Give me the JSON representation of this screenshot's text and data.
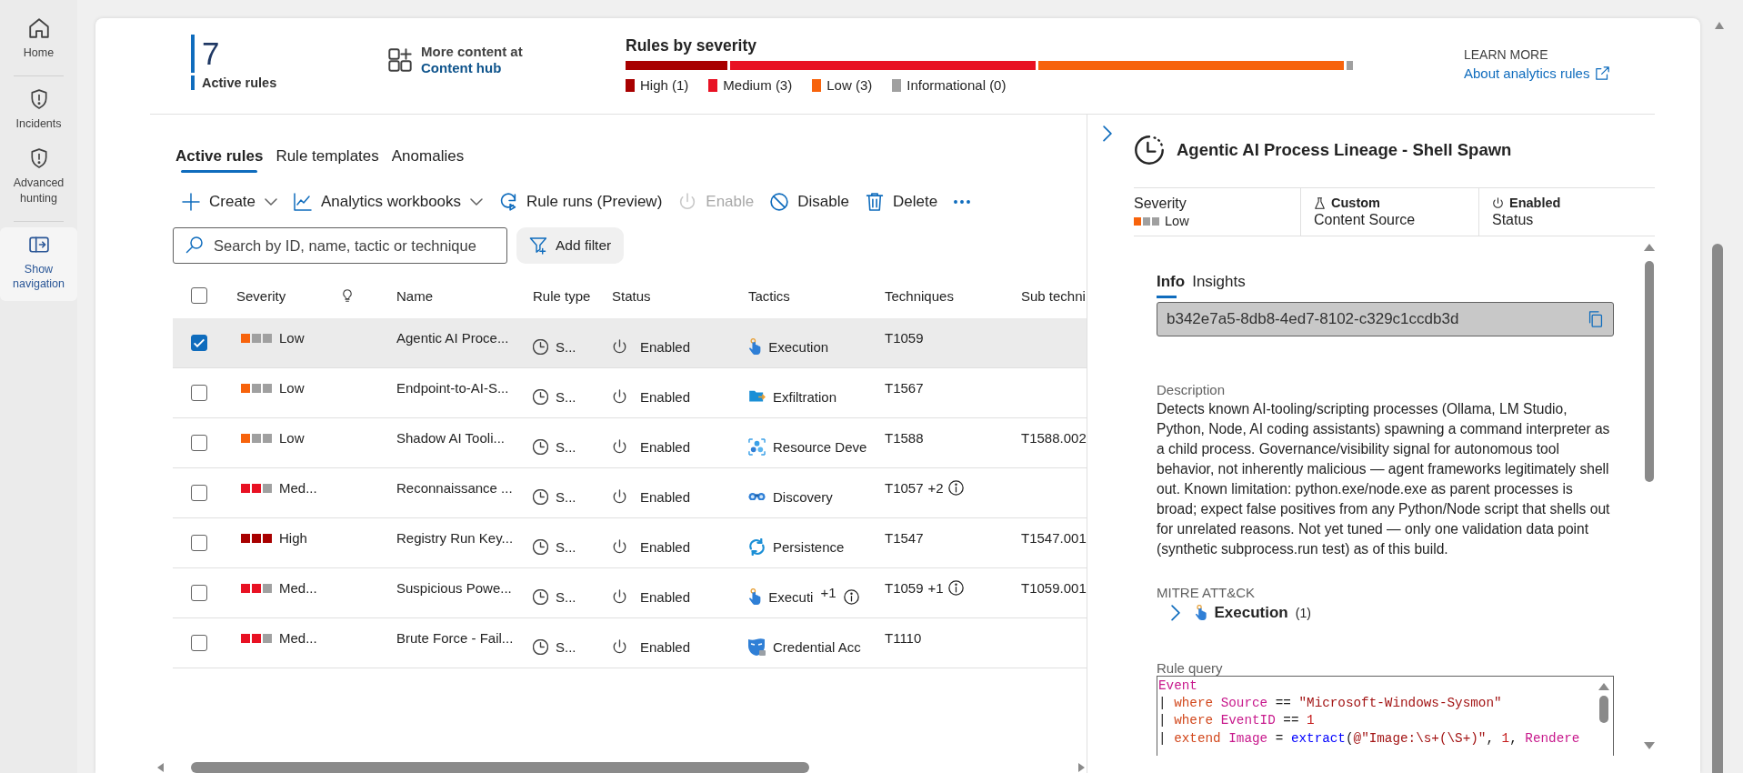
{
  "nav": [
    {
      "label": "Home",
      "kind": "home",
      "selected": false,
      "divider_after": true
    },
    {
      "label": "Incidents",
      "kind": "shield",
      "selected": false,
      "divider_after": false
    },
    {
      "label": "Advanced hunting",
      "kind": "shield",
      "selected": false,
      "divider_after": true
    },
    {
      "label": "Show navigation",
      "kind": "panel",
      "selected": true,
      "divider_after": false
    }
  ],
  "summary": {
    "count": "7",
    "count_label": "Active rules",
    "hub_line": "More content at",
    "hub_link": "Content hub",
    "learn_more": "LEARN MORE",
    "learn_link": "About analytics rules",
    "severity_title": "Rules by severity",
    "severity_segments": [
      {
        "label": "High (1)",
        "color": "#a80000",
        "level": 0.14
      },
      {
        "label": "Medium (3)",
        "color": "#e81123",
        "level": 0.42
      },
      {
        "label": "Low (3)",
        "color": "#f7630c",
        "level": 0.42
      },
      {
        "label": "Informational (0)",
        "color": "#a0a0a0",
        "level": 0.01
      }
    ]
  },
  "tabs": [
    {
      "label": "Active rules",
      "selected": true
    },
    {
      "label": "Rule templates",
      "selected": false
    },
    {
      "label": "Anomalies",
      "selected": false
    }
  ],
  "toolbar": [
    {
      "label": "Create",
      "kind": "add",
      "dropdown": true,
      "disabled": false
    },
    {
      "label": "Analytics workbooks",
      "kind": "chart",
      "dropdown": true,
      "disabled": false
    },
    {
      "label": "Rule runs (Preview)",
      "kind": "runs",
      "dropdown": false,
      "disabled": false
    },
    {
      "label": "Enable",
      "kind": "power",
      "dropdown": false,
      "disabled": true
    },
    {
      "label": "Disable",
      "kind": "block",
      "dropdown": false,
      "disabled": false
    },
    {
      "label": "Delete",
      "kind": "trash",
      "dropdown": false,
      "disabled": false
    },
    {
      "kind": "more",
      "dropdown": false,
      "disabled": false
    }
  ],
  "search": {
    "placeholder": "Search by ID, name, tactic or technique"
  },
  "filter_button": "Add filter",
  "table": {
    "all_selected": false,
    "columns": [
      {
        "label": "Severity"
      },
      {
        "kind": "bulb"
      },
      {
        "label": "Name"
      },
      {
        "label": "Rule type"
      },
      {
        "label": "Status"
      },
      {
        "label": "Tactics"
      },
      {
        "label": "Techniques"
      },
      {
        "label": "Sub techni"
      }
    ],
    "rows": [
      {
        "selected": true,
        "severity": {
          "kind": "low",
          "text": "Low"
        },
        "name": "Agentic AI Proce...",
        "rule_type": "S...",
        "status": "Enabled",
        "tactic": {
          "kind": "execution",
          "text": "Execution"
        },
        "technique": "T1059"
      },
      {
        "selected": false,
        "severity": {
          "kind": "low",
          "text": "Low"
        },
        "name": "Endpoint-to-AI-S...",
        "rule_type": "S...",
        "status": "Enabled",
        "tactic": {
          "kind": "exfiltration",
          "text": "Exfiltration"
        },
        "technique": "T1567"
      },
      {
        "selected": false,
        "severity": {
          "kind": "low",
          "text": "Low"
        },
        "name": "Shadow AI Tooli...",
        "rule_type": "S...",
        "status": "Enabled",
        "tactic": {
          "kind": "resource",
          "text": "Resource Deve"
        },
        "technique": "T1588",
        "sub_technique": "T1588.002"
      },
      {
        "selected": false,
        "severity": {
          "kind": "medium",
          "text": "Med..."
        },
        "name": "Reconnaissance ...",
        "rule_type": "S...",
        "status": "Enabled",
        "tactic": {
          "kind": "discovery",
          "text": "Discovery"
        },
        "technique": "T1057",
        "technique_extra": "+2"
      },
      {
        "selected": false,
        "severity": {
          "kind": "high",
          "text": "High"
        },
        "name": "Registry Run Key...",
        "rule_type": "S...",
        "status": "Enabled",
        "tactic": {
          "kind": "persistence",
          "text": "Persistence"
        },
        "technique": "T1547",
        "sub_technique": "T1547.001"
      },
      {
        "selected": false,
        "severity": {
          "kind": "medium",
          "text": "Med..."
        },
        "name": "Suspicious Powe...",
        "rule_type": "S...",
        "status": "Enabled",
        "tactic": {
          "kind": "execution",
          "text": "Executi"
        },
        "tactic_extra": "+1",
        "technique": "T1059",
        "technique_extra": "+1",
        "sub_technique": "T1059.001"
      },
      {
        "selected": false,
        "severity": {
          "kind": "medium",
          "text": "Med..."
        },
        "name": "Brute Force - Fail...",
        "rule_type": "S...",
        "status": "Enabled",
        "tactic": {
          "kind": "credential",
          "text": "Credential Acc"
        },
        "technique": "T1110"
      }
    ]
  },
  "detail": {
    "title": "Agentic AI Process Lineage - Shell Spawn",
    "severity_label": "Severity",
    "severity": {
      "kind": "low",
      "text": "Low"
    },
    "source": "Custom",
    "source_label": "Content Source",
    "status": "Enabled",
    "status_label": "Status",
    "tabs": [
      {
        "label": "Info",
        "selected": true
      },
      {
        "label": "Insights",
        "selected": false
      }
    ],
    "rule_id": "b342e7a5-8db8-4ed7-8102-c329c1ccdb3d",
    "description_label": "Description",
    "description": "Detects known AI-tooling/scripting processes (Ollama, LM Studio, Python, Node, AI coding assistants) spawning a command interpreter as a child process. Governance/visibility signal for autonomous tool behavior, not inherently malicious — agent frameworks legitimately shell out. Known limitation: python.exe/node.exe as parent processes is broad; expect false positives from any Python/Node script that shells out for unrelated reasons. Not yet tuned — only one validation data point (synthetic subprocess.run test) as of this build.",
    "mitre_label": "MITRE ATT&CK",
    "tactics": [
      {
        "kind": "execution",
        "name": "Execution",
        "count": "(1)",
        "expanded": false
      }
    ],
    "query_label": "Rule query",
    "query": [
      [
        {
          "kind": "table",
          "text": "Event"
        }
      ],
      [
        {
          "kind": "plain",
          "text": "| "
        },
        {
          "kind": "keyword",
          "text": "where "
        },
        {
          "kind": "ident",
          "text": "Source"
        },
        {
          "kind": "plain",
          "text": " == "
        },
        {
          "kind": "string",
          "text": "\"Microsoft-Windows-Sysmon\""
        }
      ],
      [
        {
          "kind": "plain",
          "text": "| "
        },
        {
          "kind": "keyword",
          "text": "where "
        },
        {
          "kind": "ident",
          "text": "EventID"
        },
        {
          "kind": "plain",
          "text": " == "
        },
        {
          "kind": "number",
          "text": "1"
        }
      ],
      [
        {
          "kind": "plain",
          "text": "| "
        },
        {
          "kind": "keyword",
          "text": "extend "
        },
        {
          "kind": "ident",
          "text": "Image"
        },
        {
          "kind": "plain",
          "text": " = "
        },
        {
          "kind": "func",
          "text": "extract"
        },
        {
          "kind": "plain",
          "text": "("
        },
        {
          "kind": "string",
          "text": "@\"Image:\\s+(\\S+)\""
        },
        {
          "kind": "plain",
          "text": ", "
        },
        {
          "kind": "number",
          "text": "1"
        },
        {
          "kind": "plain",
          "text": ", "
        },
        {
          "kind": "ident",
          "text": "Rendere"
        }
      ]
    ]
  }
}
